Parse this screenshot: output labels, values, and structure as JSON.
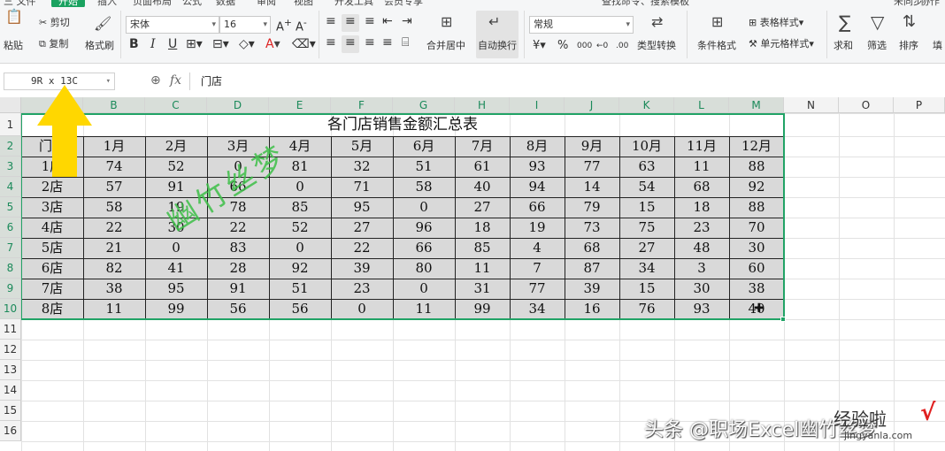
{
  "menu_strip": {
    "items": [
      "三 文件",
      "开始",
      "插入",
      "页面布局",
      "公式",
      "数据",
      "审阅",
      "视图",
      "开发工具",
      "会员专享",
      "查找命令、搜索模板",
      "未同步",
      "协作"
    ],
    "active_index": 1
  },
  "ribbon": {
    "cut": "剪切",
    "copy": "复制",
    "paste": "粘贴",
    "format_painter": "格式刷",
    "font_name": "宋体",
    "font_size": "16",
    "bold": "B",
    "italic": "I",
    "underline": "U",
    "merge_center": "合并居中",
    "auto_wrap": "自动换行",
    "number_format": "常规",
    "type_convert": "类型转换",
    "conditional_format": "条件格式",
    "table_style": "表格样式",
    "cell_style": "单元格样式",
    "sum": "求和",
    "filter": "筛选",
    "sort": "排序",
    "fill": "填",
    "currency": "¥",
    "percent": "%",
    "thousands": "000"
  },
  "formula_bar": {
    "name_box": "9R x 13C",
    "fx": "fx",
    "content": "门店"
  },
  "columns": [
    "B",
    "C",
    "D",
    "E",
    "F",
    "G",
    "H",
    "I",
    "J",
    "K",
    "L",
    "M",
    "N",
    "O",
    "P"
  ],
  "rows": [
    "1",
    "2",
    "3",
    "4",
    "5",
    "6",
    "7",
    "8",
    "9",
    "10",
    "11",
    "12",
    "13",
    "14",
    "15",
    "16"
  ],
  "sheet": {
    "title": "各门店销售金额汇总表",
    "header_row": [
      "门店",
      "1月",
      "2月",
      "3月",
      "4月",
      "5月",
      "6月",
      "7月",
      "8月",
      "9月",
      "10月",
      "11月",
      "12月"
    ],
    "data_rows": [
      [
        "1店",
        "74",
        "52",
        "0",
        "81",
        "32",
        "51",
        "61",
        "93",
        "77",
        "63",
        "11",
        "88"
      ],
      [
        "2店",
        "57",
        "91",
        "66",
        "0",
        "71",
        "58",
        "40",
        "94",
        "14",
        "54",
        "68",
        "92"
      ],
      [
        "3店",
        "58",
        "19",
        "78",
        "85",
        "95",
        "0",
        "27",
        "66",
        "79",
        "15",
        "18",
        "88"
      ],
      [
        "4店",
        "22",
        "30",
        "22",
        "52",
        "27",
        "96",
        "18",
        "19",
        "73",
        "75",
        "23",
        "70"
      ],
      [
        "5店",
        "21",
        "0",
        "83",
        "0",
        "22",
        "66",
        "85",
        "4",
        "68",
        "27",
        "48",
        "30"
      ],
      [
        "6店",
        "82",
        "41",
        "28",
        "92",
        "39",
        "80",
        "11",
        "7",
        "87",
        "34",
        "3",
        "60"
      ],
      [
        "7店",
        "38",
        "95",
        "91",
        "51",
        "23",
        "0",
        "31",
        "77",
        "39",
        "15",
        "30",
        "38"
      ],
      [
        "8店",
        "11",
        "99",
        "56",
        "56",
        "0",
        "11",
        "99",
        "34",
        "16",
        "76",
        "93",
        "40"
      ]
    ]
  },
  "overlays": {
    "watermark": "幽竹丝梦",
    "credit": "头条 @职场Excel幽竹丝梦",
    "site_logo": "经验啦",
    "site_url": "jingyanla.com",
    "site_check": "√"
  },
  "colors": {
    "selection": "#21a366",
    "watermark": "#3cbe46",
    "arrow": "#ffd700",
    "selected_fill": "#d9d9d9"
  }
}
